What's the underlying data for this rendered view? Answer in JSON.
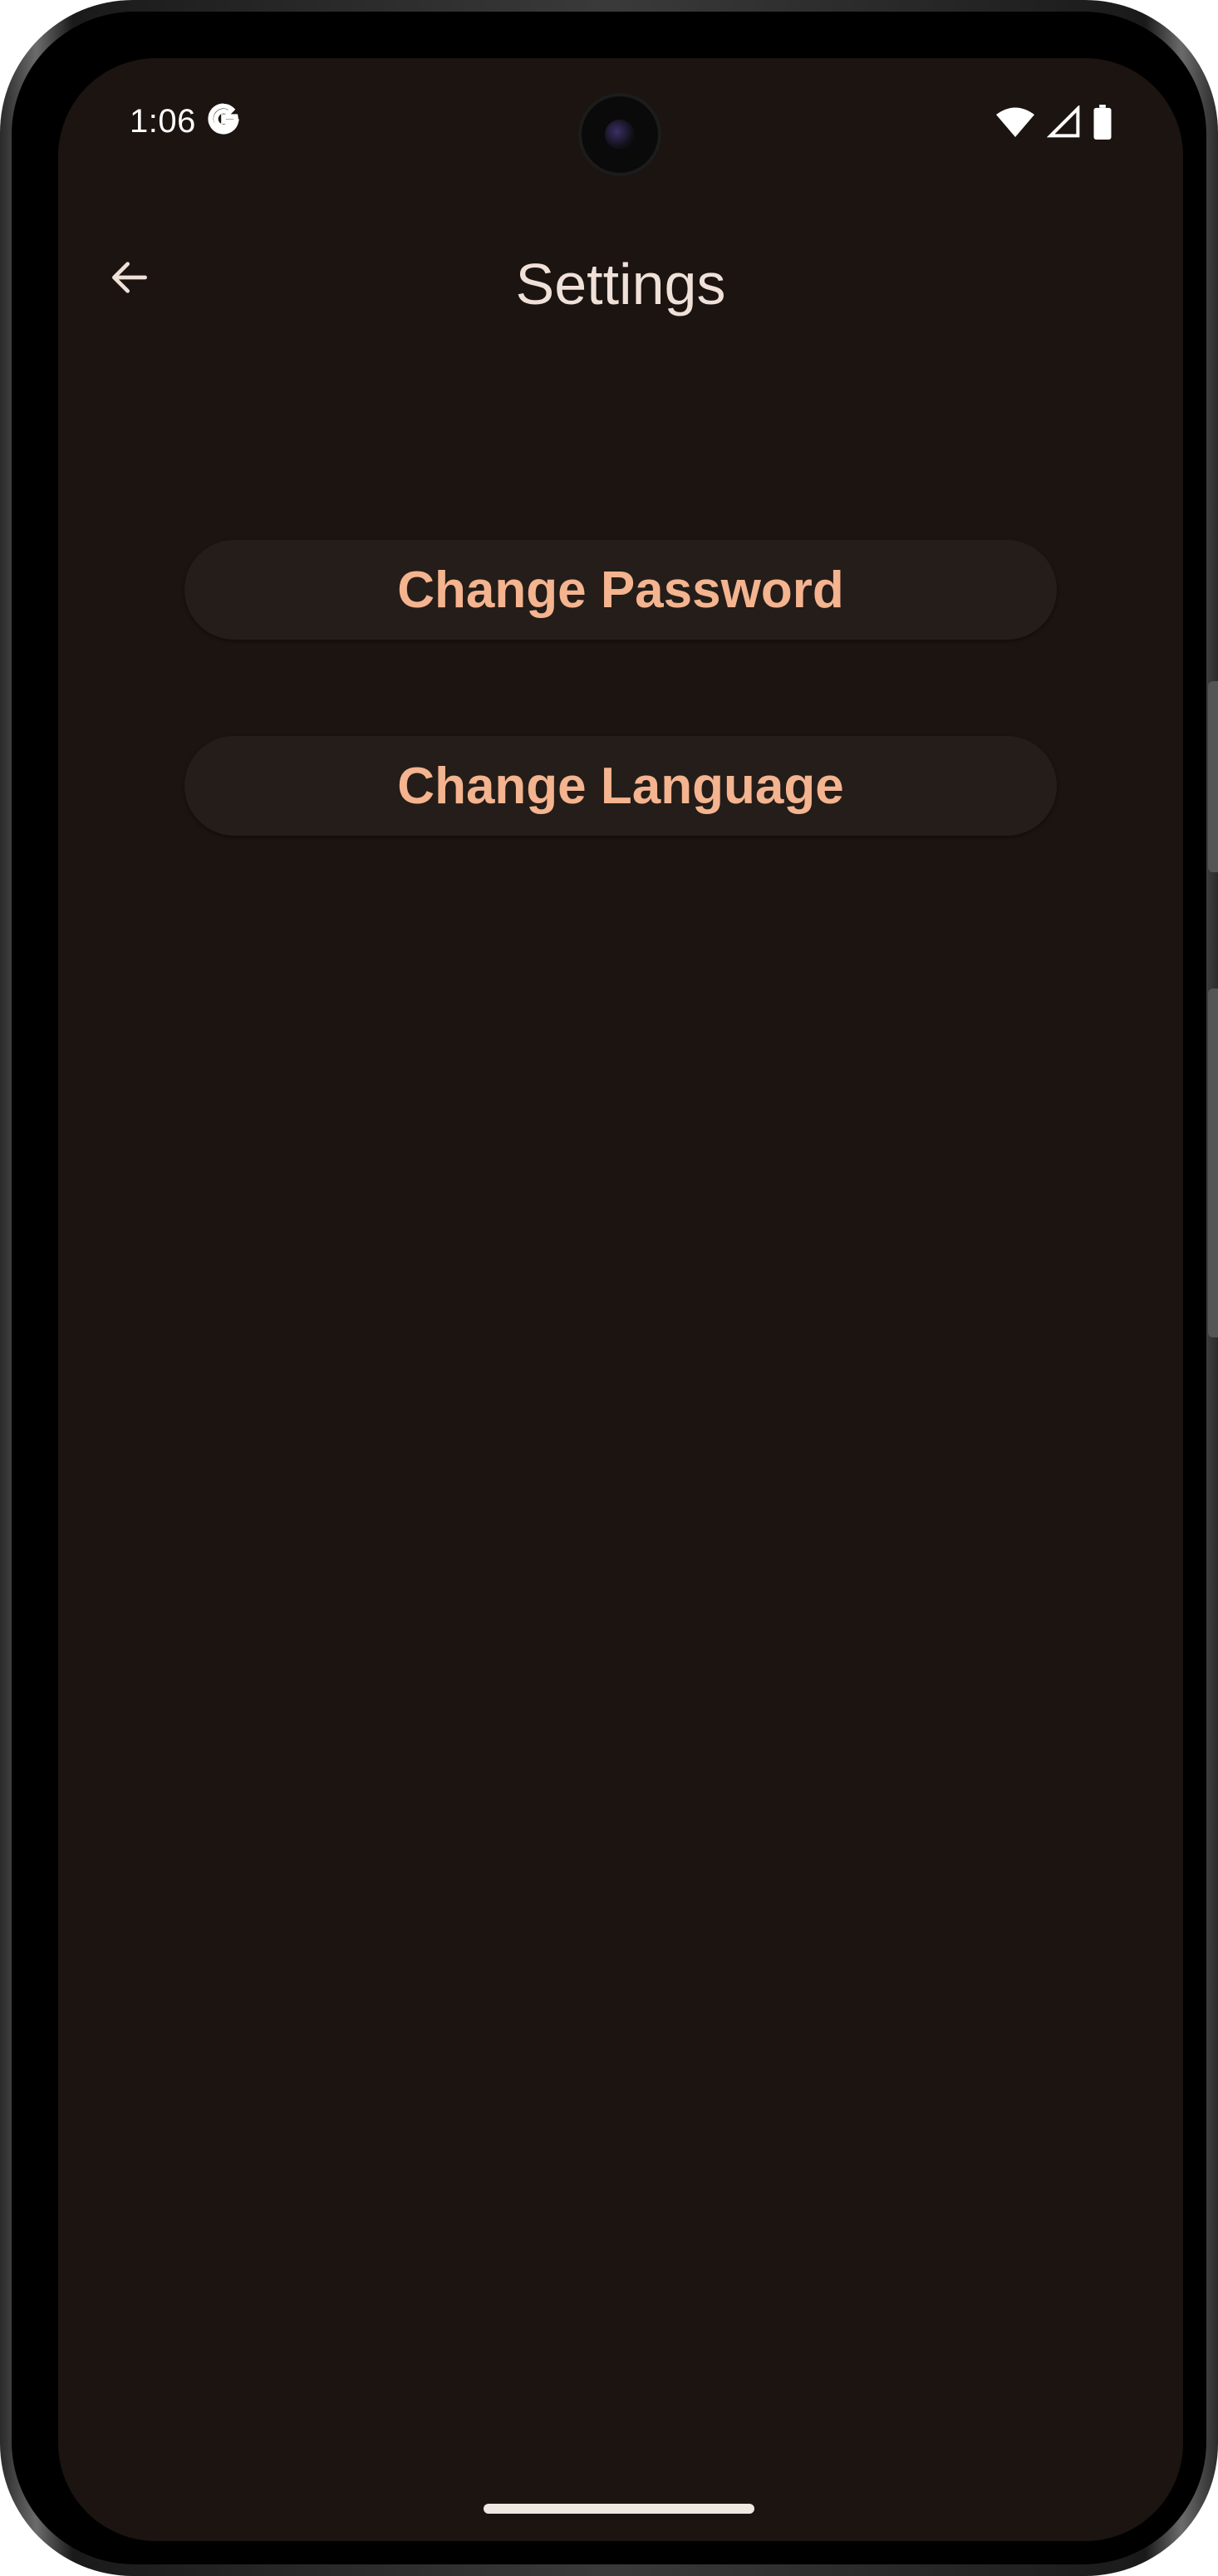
{
  "status_bar": {
    "time": "1:06",
    "google_icon": "google-g-icon",
    "icons": [
      "wifi-icon",
      "signal-icon",
      "battery-icon"
    ]
  },
  "top_bar": {
    "back_icon": "arrow-back-icon",
    "title": "Settings"
  },
  "actions": [
    {
      "label": "Change Password"
    },
    {
      "label": "Change Language"
    }
  ],
  "colors": {
    "background": "#1b1410",
    "button_bg": "#241d19",
    "button_text": "#f4b48f",
    "title_text": "#efe0d8"
  }
}
